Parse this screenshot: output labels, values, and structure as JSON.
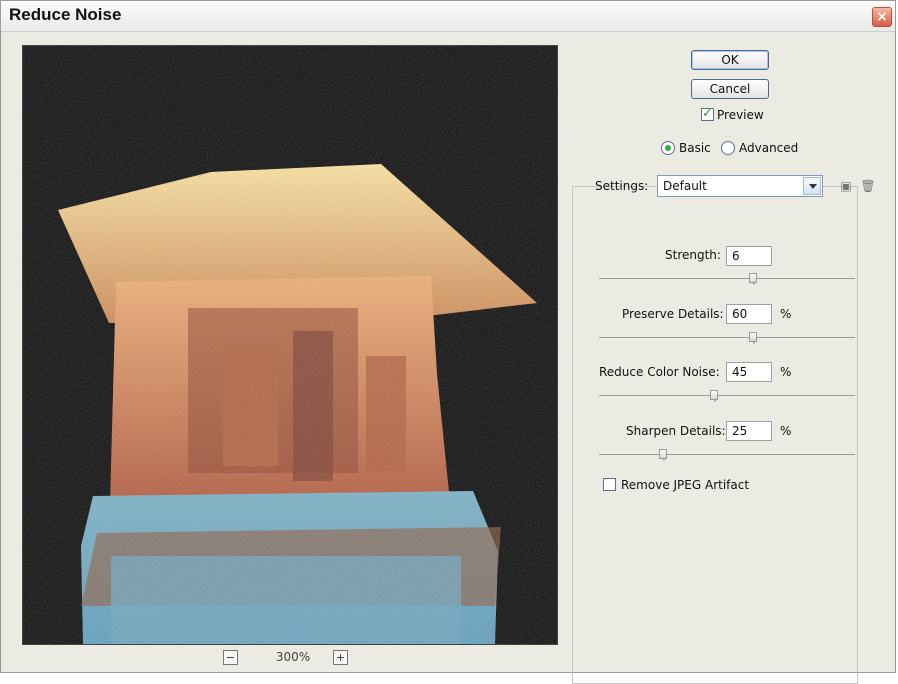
{
  "dialog": {
    "title": "Reduce Noise",
    "close_icon": "close-icon"
  },
  "preview": {
    "zoom_out_icon": "zoom-out-icon",
    "zoom_in_icon": "zoom-in-icon",
    "zoom_level": "300%"
  },
  "buttons": {
    "ok": "OK",
    "cancel": "Cancel"
  },
  "preview_checkbox": {
    "label": "Preview",
    "checked": true
  },
  "mode": {
    "basic": "Basic",
    "advanced": "Advanced",
    "selected": "Basic"
  },
  "settings": {
    "label": "Settings:",
    "selected": "Default",
    "save_icon": "save-settings-icon",
    "delete_icon": "trash-icon"
  },
  "controls": {
    "strength": {
      "label": "Strength:",
      "value": "6",
      "unit": "",
      "slider_fraction": 0.6
    },
    "preserve_details": {
      "label": "Preserve Details:",
      "value": "60",
      "unit": "%",
      "slider_fraction": 0.6
    },
    "reduce_color_noise": {
      "label": "Reduce Color Noise:",
      "value": "45",
      "unit": "%",
      "slider_fraction": 0.45
    },
    "sharpen_details": {
      "label": "Sharpen Details:",
      "value": "25",
      "unit": "%",
      "slider_fraction": 0.25
    }
  },
  "remove_jpeg": {
    "label": "Remove JPEG Artifact",
    "checked": false
  },
  "colors": {
    "accent": "#31aa3e",
    "close_red": "#d95b45",
    "button_border": "#4a6b8f"
  }
}
